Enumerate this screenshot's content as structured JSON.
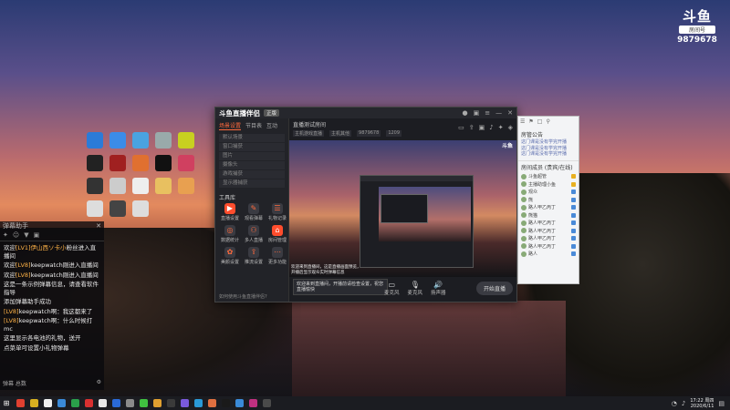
{
  "watermark": {
    "logo": "斗鱼",
    "sub": "房间号",
    "room_number": "9879678"
  },
  "desktop_icons": [
    {
      "name": "icon-1",
      "color": "#2b7bd8"
    },
    {
      "name": "icon-2",
      "color": "#3b8ce8"
    },
    {
      "name": "icon-3",
      "color": "#4aa3e0"
    },
    {
      "name": "icon-4",
      "color": "#9aa"
    },
    {
      "name": "icon-5",
      "color": "#c8d020"
    },
    {
      "name": "icon-6",
      "color": "#222"
    },
    {
      "name": "icon-7",
      "color": "#a02020"
    },
    {
      "name": "icon-8",
      "color": "#e07030"
    },
    {
      "name": "icon-9",
      "color": "#111"
    },
    {
      "name": "icon-10",
      "color": "#d04060"
    },
    {
      "name": "icon-11",
      "color": "#333"
    },
    {
      "name": "icon-12",
      "color": "#ccc"
    },
    {
      "name": "icon-13",
      "color": "#eee"
    },
    {
      "name": "icon-14",
      "color": "#e8c060"
    },
    {
      "name": "icon-15",
      "color": "#e8a050"
    },
    {
      "name": "icon-16",
      "color": "#ddd"
    },
    {
      "name": "icon-17",
      "color": "#444"
    },
    {
      "name": "icon-18",
      "color": "#ddd"
    }
  ],
  "chat": {
    "title": "弹幕助手",
    "lines": [
      {
        "pre": "欢迎",
        "hl": "[LV1]伊山西ソ卡小",
        "post": "粉丝进入直播间"
      },
      {
        "pre": "欢迎",
        "hl": "[LV8]",
        "post": "keepwatch刚进入直播间"
      },
      {
        "pre": "欢迎",
        "hl": "[LV8]",
        "post": "keepwatch刚进入直播间"
      },
      {
        "pre": "",
        "hl": "",
        "post": "这是一条示例弹幕信息，请查看软件指导"
      },
      {
        "pre": "",
        "hl": "",
        "post": "添加弹幕助手成功"
      },
      {
        "pre": "",
        "hl": "[LV8]",
        "post": "keepwatch啊：我这都来了"
      },
      {
        "pre": "",
        "hl": "[LV8]",
        "post": "keepwatch啊：什么时候打mc"
      },
      {
        "pre": "",
        "hl": "",
        "post": "这里显示各电池的礼物，送开"
      },
      {
        "pre": "",
        "hl": "",
        "post": "点菜单可设置小礼物弹幕"
      }
    ],
    "footer_left": "弹幕 总数",
    "footer_right": "⚙"
  },
  "obs": {
    "logo": "斗鱼直播伴侣",
    "version": "正版",
    "tabs": [
      "场景设置",
      "节目表",
      "互动"
    ],
    "scenes": [
      "默认场景",
      "窗口捕获",
      "图片",
      "摄像头",
      "游戏捕获",
      "显示器捕获"
    ],
    "tools_title": "工具库",
    "tools": [
      {
        "label": "直播设置",
        "glyph": "▶",
        "active": true
      },
      {
        "label": "观看弹幕",
        "glyph": "✎",
        "active": false
      },
      {
        "label": "礼物记录",
        "glyph": "☰",
        "active": false
      },
      {
        "label": "数据统计",
        "glyph": "◎",
        "active": false
      },
      {
        "label": "多人直播",
        "glyph": "⚇",
        "active": false
      },
      {
        "label": "房间管理",
        "glyph": "⌂",
        "active": true
      },
      {
        "label": "美颜设置",
        "glyph": "✿",
        "active": false
      },
      {
        "label": "推流设置",
        "glyph": "⇪",
        "active": false
      },
      {
        "label": "更多功能",
        "glyph": "⋯",
        "active": false
      }
    ],
    "bottom_note": "如何使用斗鱼直播伴侣?",
    "room_title": "直播测试房间",
    "room_tags": [
      "主机游戏直播",
      "主机其他",
      "9879678",
      "1209"
    ],
    "preview_badge": "斗鱼",
    "preview_caption": "欢迎来到直播间，这是直播画面预览，开播后显示观众实时弹幕信息",
    "live_tip": "欢迎来到直播间，开播前请检查设置，祝您直播愉快",
    "controls": [
      {
        "label": "麦克风",
        "glyph": "▭"
      },
      {
        "label": "麦克风",
        "glyph": "🎙"
      },
      {
        "label": "扬声器",
        "glyph": "🔊"
      }
    ],
    "live_button": "开始直播"
  },
  "viewers": {
    "header_tabs": [
      "☰",
      "⚑",
      "□",
      "⚲"
    ],
    "title": "房管公告",
    "announcements": [
      "这门课是没有学完开播",
      "这门课是没有学完开播",
      "这门课是没有学完开播"
    ],
    "section": "房间成员 (贵宾/在线)",
    "users": [
      {
        "name": "斗鱼超管",
        "badge": "gold"
      },
      {
        "name": "主播助理小鱼",
        "badge": "gold"
      },
      {
        "name": "观众",
        "badge": "blue"
      },
      {
        "name": "熊",
        "badge": "blue"
      },
      {
        "name": "路人甲乙丙丁",
        "badge": "blue"
      },
      {
        "name": "熊猫",
        "badge": "blue"
      },
      {
        "name": "路人甲乙丙丁",
        "badge": "blue"
      },
      {
        "name": "路人甲乙丙丁",
        "badge": "blue"
      },
      {
        "name": "路人甲乙丙丁",
        "badge": "blue"
      },
      {
        "name": "路人甲乙丙丁",
        "badge": "blue"
      },
      {
        "name": "路人",
        "badge": "blue"
      }
    ]
  },
  "taskbar": {
    "apps": [
      "#e04030",
      "#d8b020",
      "#f0f0f0",
      "#3a8ad8",
      "#2aa04a",
      "#d83030",
      "#e8e8e8",
      "#2a6ad8",
      "#8a8a8a",
      "#40c040",
      "#e0a030",
      "#3a3a3a",
      "#7a5adc",
      "#2a9ad8",
      "#e07040",
      "#1a1a1a",
      "#3a8ad8",
      "#c03080",
      "#4a4a4a"
    ],
    "time": "17:22 周四",
    "date": "2020/6/11"
  }
}
